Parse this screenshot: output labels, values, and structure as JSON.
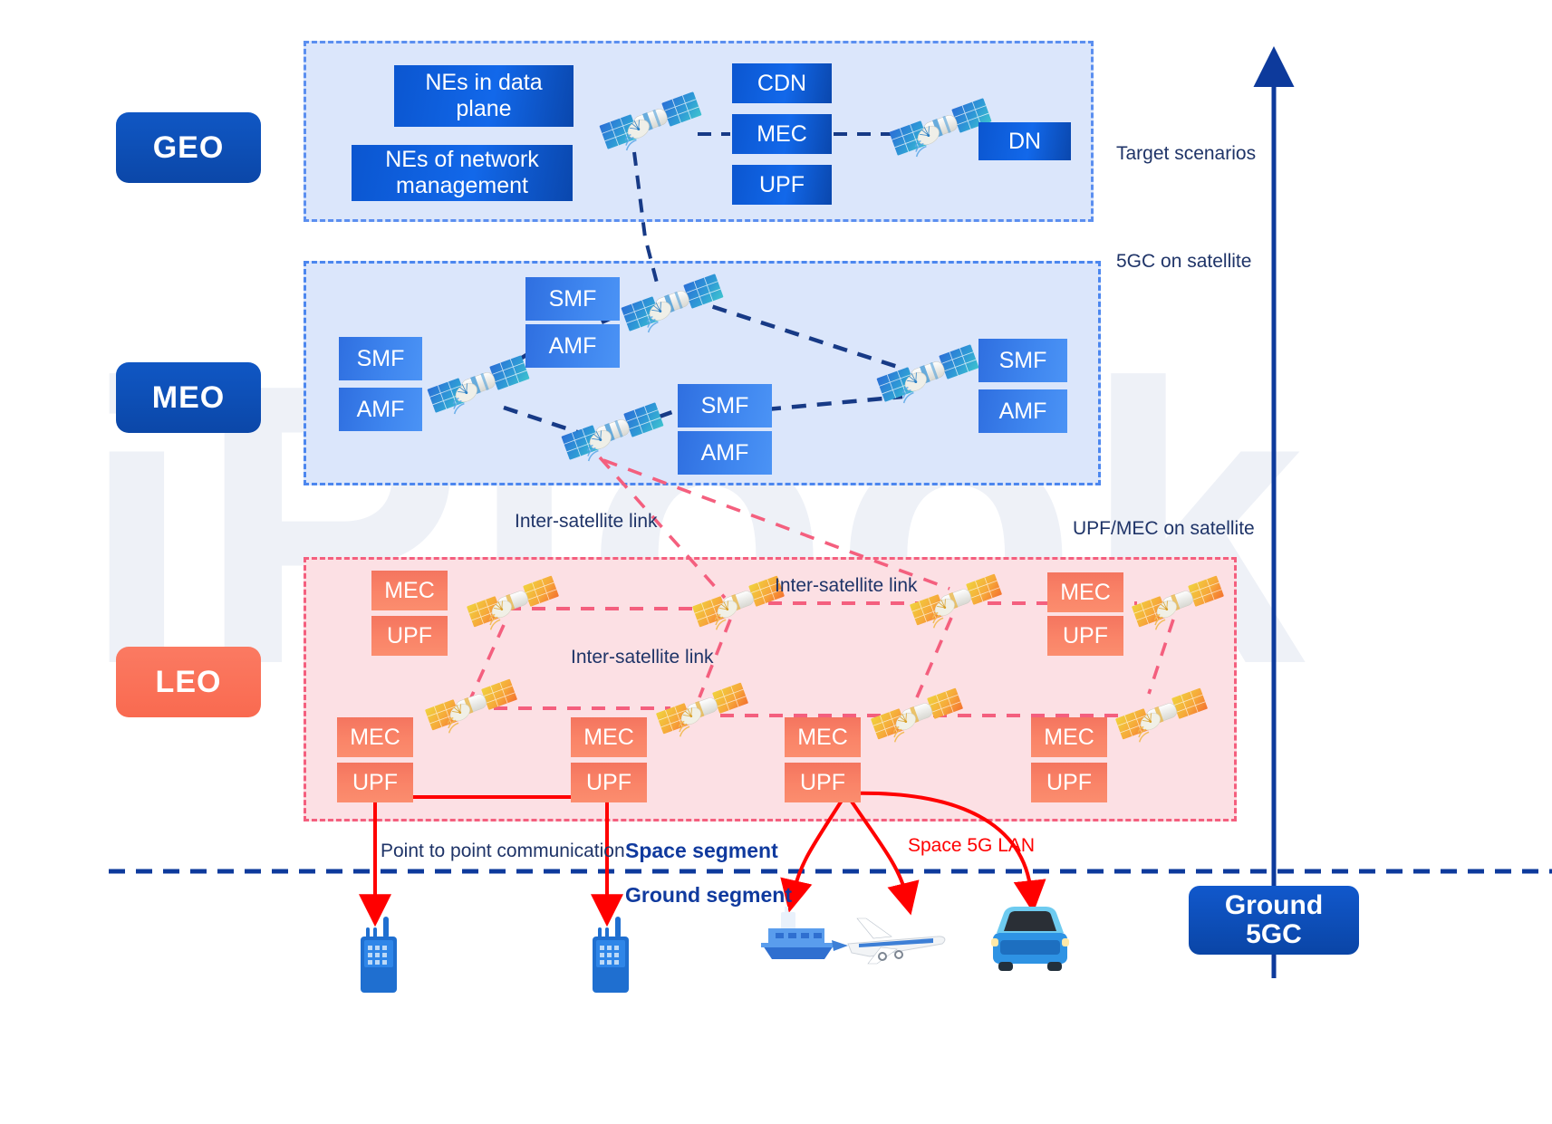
{
  "watermark": "iPlook",
  "orbits": [
    {
      "id": "geo",
      "label": "GEO"
    },
    {
      "id": "meo",
      "label": "MEO"
    },
    {
      "id": "leo",
      "label": "LEO"
    }
  ],
  "right_labels": [
    {
      "id": "target-scenarios",
      "text": "Target scenarios"
    },
    {
      "id": "5gc-on-satellite",
      "text": "5GC on satellite"
    },
    {
      "id": "upf-mec-on-satellite",
      "text": "UPF/MEC on satellite"
    }
  ],
  "geo": {
    "boxes": [
      {
        "id": "nes-data-plane",
        "text": "NEs in data plane"
      },
      {
        "id": "nes-network-management",
        "text": "NEs of network management"
      },
      {
        "id": "cdn",
        "text": "CDN"
      },
      {
        "id": "mec",
        "text": "MEC"
      },
      {
        "id": "upf",
        "text": "UPF"
      },
      {
        "id": "dn",
        "text": "DN"
      }
    ]
  },
  "meo": {
    "boxes": [
      {
        "id": "smf-left",
        "text": "SMF"
      },
      {
        "id": "amf-left",
        "text": "AMF"
      },
      {
        "id": "smf-top",
        "text": "SMF"
      },
      {
        "id": "amf-top",
        "text": "AMF"
      },
      {
        "id": "smf-center",
        "text": "SMF"
      },
      {
        "id": "amf-center",
        "text": "AMF"
      },
      {
        "id": "smf-right",
        "text": "SMF"
      },
      {
        "id": "amf-right",
        "text": "AMF"
      }
    ]
  },
  "leo": {
    "boxes": [
      {
        "id": "mec-r1-c1",
        "text": "MEC"
      },
      {
        "id": "upf-r1-c1",
        "text": "UPF"
      },
      {
        "id": "mec-r1-c4",
        "text": "MEC"
      },
      {
        "id": "upf-r1-c4",
        "text": "UPF"
      },
      {
        "id": "mec-r2-c1",
        "text": "MEC"
      },
      {
        "id": "upf-r2-c1",
        "text": "UPF"
      },
      {
        "id": "mec-r2-c2",
        "text": "MEC"
      },
      {
        "id": "upf-r2-c2",
        "text": "UPF"
      },
      {
        "id": "mec-r2-c3",
        "text": "MEC"
      },
      {
        "id": "upf-r2-c3",
        "text": "UPF"
      },
      {
        "id": "mec-r2-c4",
        "text": "MEC"
      },
      {
        "id": "upf-r2-c4",
        "text": "UPF"
      }
    ],
    "link_labels": [
      {
        "id": "isl-top",
        "text": "Inter-satellite link"
      },
      {
        "id": "isl-right",
        "text": "Inter-satellite link"
      },
      {
        "id": "isl-middle",
        "text": "Inter-satellite link"
      }
    ]
  },
  "annotations": {
    "point_to_point": "Point to point communication",
    "space_segment": "Space segment",
    "ground_segment": "Ground segment",
    "space_5g_lan": "Space 5G LAN"
  },
  "ground": {
    "node_label": "Ground\n5GC",
    "node_line1": "Ground",
    "node_line2": "5GC",
    "devices": [
      {
        "id": "handheld-radio-1",
        "icon": "walkie-talkie-icon"
      },
      {
        "id": "handheld-radio-2",
        "icon": "walkie-talkie-icon"
      },
      {
        "id": "ship",
        "icon": "ship-icon"
      },
      {
        "id": "airplane",
        "icon": "airplane-icon"
      },
      {
        "id": "car",
        "icon": "car-icon"
      }
    ]
  },
  "colors": {
    "brand_blue": "#0b47a8",
    "accent_blue": "#1268ea",
    "leo_orange": "#f96a50",
    "region_blue_fill": "#dbe6fb",
    "region_blue_border": "#4c87ef",
    "region_pink_fill": "#fce0e4",
    "region_pink_border": "#f45f7e",
    "red_arrow": "#ff0000",
    "dark_navy": "#1f3468"
  }
}
